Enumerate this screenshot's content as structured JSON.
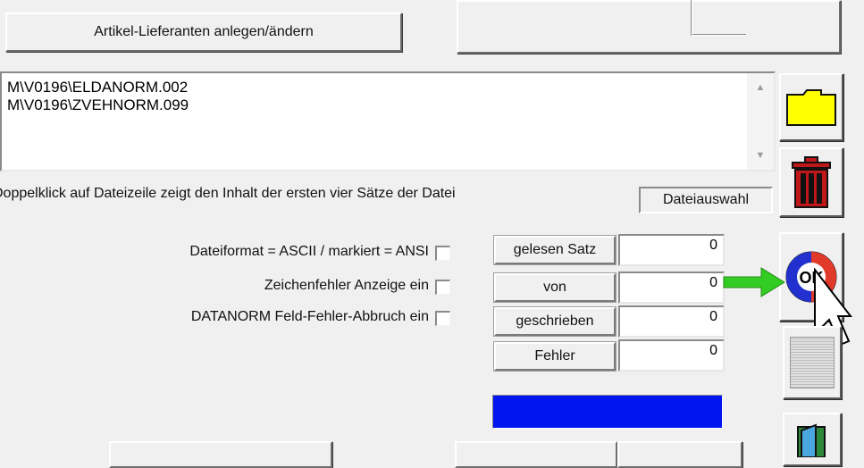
{
  "top": {
    "lieferanten_button": "Artikel-Lieferanten anlegen/ändern"
  },
  "files": [
    "M\\V0196\\ELDANORM.002",
    "M\\V0196\\ZVEHNORM.099"
  ],
  "hint": "Doppelklick auf Dateizeile zeigt den Inhalt der ersten vier Sätze der Datei",
  "dateiauswahl_label": "Dateiauswahl",
  "options": [
    {
      "label": "Dateiformat = ASCII / markiert = ANSI",
      "checked": false
    },
    {
      "label": "Zeichenfehler Anzeige ein",
      "checked": false
    },
    {
      "label": "DATANORM Feld-Fehler-Abbruch ein",
      "checked": false
    }
  ],
  "stats": [
    {
      "label": "gelesen Satz",
      "value": "0"
    },
    {
      "label": "von",
      "value": "0"
    },
    {
      "label": "geschrieben",
      "value": "0"
    },
    {
      "label": "Fehler",
      "value": "0"
    }
  ],
  "icons": {
    "folder": "folder-icon",
    "trash": "trash-icon",
    "ok": "ok-icon",
    "ok_text": "OK",
    "arrow": "arrow-right-icon",
    "cursor": "mouse-cursor-icon",
    "grid": "grid-icon",
    "exit": "exit-door-icon"
  },
  "colors": {
    "progress": "#0015f0",
    "arrow": "#33cc22",
    "folder": "#ffff00",
    "trash": "#c01818"
  }
}
